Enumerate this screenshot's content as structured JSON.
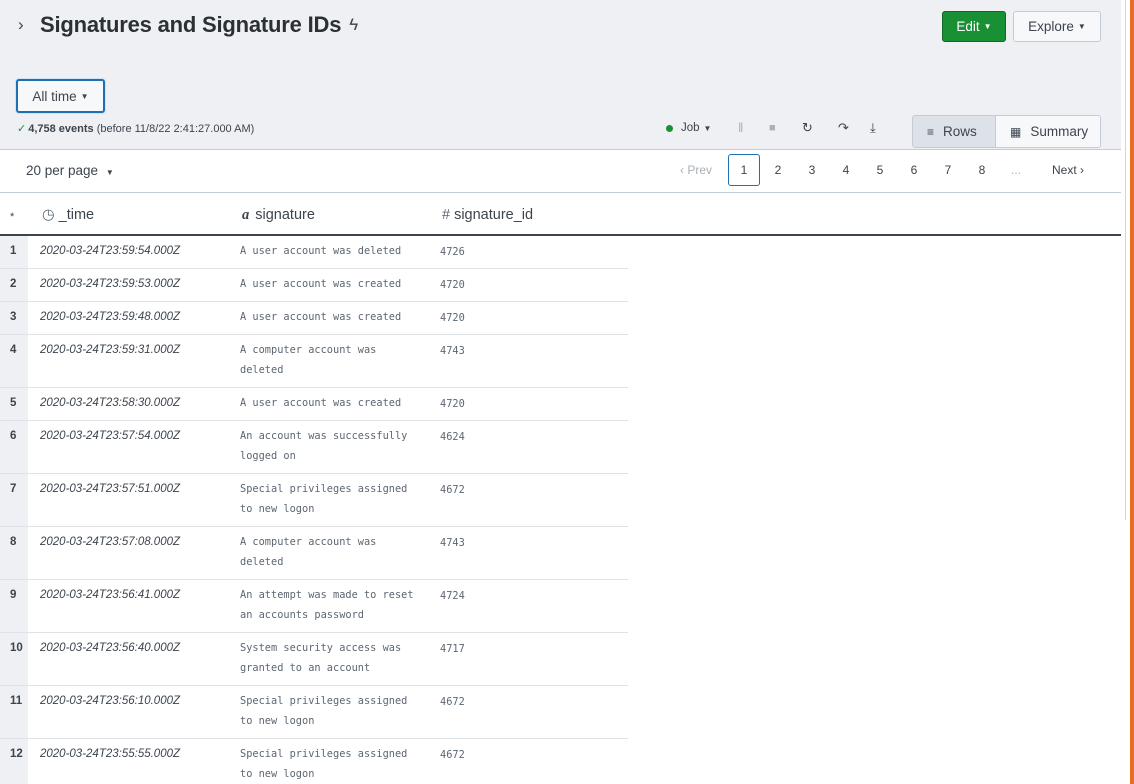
{
  "header": {
    "title": "Signatures and Signature IDs",
    "edit_label": "Edit",
    "explore_label": "Explore"
  },
  "search": {
    "time_range_label": "All time",
    "event_count": "4,758 events",
    "event_suffix": "(before 11/8/22 2:41:27.000 AM)",
    "job_label": "Job"
  },
  "view_toggle": {
    "rows_label": "Rows",
    "summary_label": "Summary"
  },
  "pager": {
    "per_page_label": "20 per page",
    "prev_label": "Prev",
    "next_label": "Next",
    "pages": [
      "1",
      "2",
      "3",
      "4",
      "5",
      "6",
      "7",
      "8"
    ],
    "current_page": "1",
    "ellipsis": "..."
  },
  "table": {
    "columns": {
      "row_marker": "*",
      "time": "_time",
      "signature": "signature",
      "signature_id": "signature_id"
    },
    "rows": [
      {
        "num": "1",
        "time": "2020-03-24T23:59:54.000Z",
        "signature": "A user account was deleted",
        "signature_id": "4726"
      },
      {
        "num": "2",
        "time": "2020-03-24T23:59:53.000Z",
        "signature": "A user account was created",
        "signature_id": "4720"
      },
      {
        "num": "3",
        "time": "2020-03-24T23:59:48.000Z",
        "signature": "A user account was created",
        "signature_id": "4720"
      },
      {
        "num": "4",
        "time": "2020-03-24T23:59:31.000Z",
        "signature": "A computer account was deleted",
        "signature_id": "4743"
      },
      {
        "num": "5",
        "time": "2020-03-24T23:58:30.000Z",
        "signature": "A user account was created",
        "signature_id": "4720"
      },
      {
        "num": "6",
        "time": "2020-03-24T23:57:54.000Z",
        "signature": "An account was successfully logged on",
        "signature_id": "4624"
      },
      {
        "num": "7",
        "time": "2020-03-24T23:57:51.000Z",
        "signature": "Special privileges assigned to new logon",
        "signature_id": "4672"
      },
      {
        "num": "8",
        "time": "2020-03-24T23:57:08.000Z",
        "signature": "A computer account was deleted",
        "signature_id": "4743"
      },
      {
        "num": "9",
        "time": "2020-03-24T23:56:41.000Z",
        "signature": "An attempt was made to reset an accounts password",
        "signature_id": "4724"
      },
      {
        "num": "10",
        "time": "2020-03-24T23:56:40.000Z",
        "signature": "System security access was granted to an account",
        "signature_id": "4717"
      },
      {
        "num": "11",
        "time": "2020-03-24T23:56:10.000Z",
        "signature": "Special privileges assigned to new logon",
        "signature_id": "4672"
      },
      {
        "num": "12",
        "time": "2020-03-24T23:55:55.000Z",
        "signature": "Special privileges assigned to new logon",
        "signature_id": "4672"
      }
    ]
  },
  "colors": {
    "accent_green": "#1a9035",
    "focus_blue": "#1e6fb3",
    "orange_edge": "#ec6b21"
  }
}
